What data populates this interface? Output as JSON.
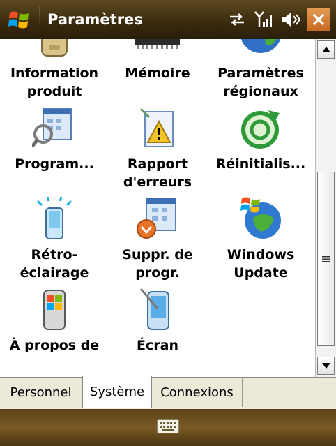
{
  "window": {
    "title": "Paramètres"
  },
  "items": [
    {
      "label": "Information\nproduit",
      "icon": "pda-device-icon"
    },
    {
      "label": "Mémoire",
      "icon": "memory-chip-icon"
    },
    {
      "label": "Paramètres\nrégionaux",
      "icon": "globe-icon"
    },
    {
      "label": "Program...",
      "icon": "program-settings-icon"
    },
    {
      "label": "Rapport\nd'erreurs",
      "icon": "error-report-icon"
    },
    {
      "label": "Réinitialis...",
      "icon": "reset-icon"
    },
    {
      "label": "Rétro-\néclairage",
      "icon": "backlight-icon"
    },
    {
      "label": "Suppr. de\nprogr.",
      "icon": "remove-programs-icon"
    },
    {
      "label": "Windows\nUpdate",
      "icon": "windows-update-icon"
    },
    {
      "label": "À propos de",
      "icon": "about-device-icon"
    },
    {
      "label": "Écran",
      "icon": "screen-stylus-icon"
    }
  ],
  "tabs": [
    {
      "label": "Personnel",
      "active": false
    },
    {
      "label": "Système",
      "active": true
    },
    {
      "label": "Connexions",
      "active": false
    }
  ],
  "colors": {
    "titlebar": "#3c2c0f",
    "close": "#c56920",
    "tabs_bg": "#ece9d8"
  }
}
